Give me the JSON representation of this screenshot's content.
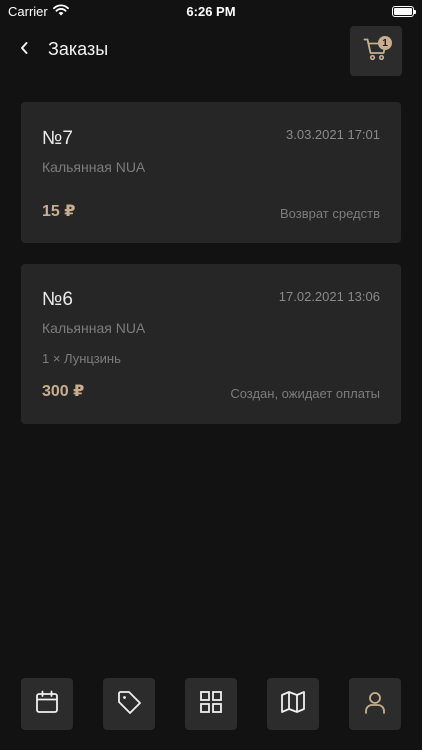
{
  "status_bar": {
    "carrier": "Carrier",
    "time": "6:26 PM",
    "battery_level": 1.0
  },
  "header": {
    "title": "Заказы",
    "cart_count": "1"
  },
  "orders": [
    {
      "number": "№7",
      "date": "3.03.2021 17:01",
      "venue": "Кальянная NUA",
      "items": "",
      "price": "15 ₽",
      "status": "Возврат средств"
    },
    {
      "number": "№6",
      "date": "17.02.2021 13:06",
      "venue": "Кальянная NUA",
      "items": "1 × Лунцзинь",
      "price": "300 ₽",
      "status": "Создан, ожидает оплаты"
    }
  ],
  "nav": [
    {
      "icon": "calendar-icon"
    },
    {
      "icon": "tag-icon"
    },
    {
      "icon": "grid-icon"
    },
    {
      "icon": "map-icon"
    },
    {
      "icon": "user-icon"
    }
  ],
  "colors": {
    "background": "#121212",
    "card": "#262626",
    "button": "#2c2c2c",
    "accent": "#c8ae8e",
    "muted_text": "#7c7c7c"
  }
}
